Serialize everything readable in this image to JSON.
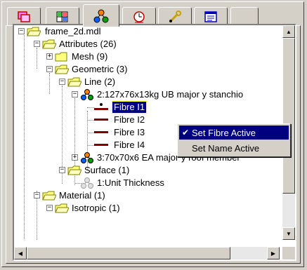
{
  "tabs": [
    {
      "icon": "windows-icon"
    },
    {
      "icon": "grid-icon"
    },
    {
      "icon": "hierarchy-icon",
      "active": true
    },
    {
      "icon": "clock-icon"
    },
    {
      "icon": "wrench-icon"
    },
    {
      "icon": "form-icon"
    }
  ],
  "tree": {
    "items": [
      {
        "label": "frame_2d.mdl",
        "icon": "folder-icon"
      },
      {
        "label": "Attributes (26)",
        "icon": "folder-open-icon"
      },
      {
        "label": "Mesh (9)",
        "icon": "folder-icon"
      },
      {
        "label": "Geometric (3)",
        "icon": "folder-open-icon"
      },
      {
        "label": "Line (2)",
        "icon": "folder-open-icon"
      },
      {
        "label": "2:127x76x13kg UB major y stanchio",
        "icon": "attribute-icon"
      },
      {
        "label": "Fibre I1",
        "icon": "fibre-active-icon"
      },
      {
        "label": "Fibre I2",
        "icon": "fibre-icon"
      },
      {
        "label": "Fibre I3",
        "icon": "fibre-icon"
      },
      {
        "label": "Fibre I4",
        "icon": "fibre-icon"
      },
      {
        "label": "3:70x70x6 EA major y roof member",
        "icon": "attribute-icon"
      },
      {
        "label": "Surface (1)",
        "icon": "folder-open-icon"
      },
      {
        "label": "1:Unit Thickness",
        "icon": "attribute-disabled-icon"
      },
      {
        "label": "Material (1)",
        "icon": "folder-open-icon"
      },
      {
        "label": "Isotropic (1)",
        "icon": "folder-open-icon"
      }
    ]
  },
  "context_menu": {
    "items": [
      {
        "label": "Set Fibre Active",
        "checked": true
      },
      {
        "label": "Set Name Active",
        "checked": false
      }
    ]
  },
  "colors": {
    "selection": "#000080",
    "fibre": "#800000",
    "folder": "#ffff80"
  }
}
